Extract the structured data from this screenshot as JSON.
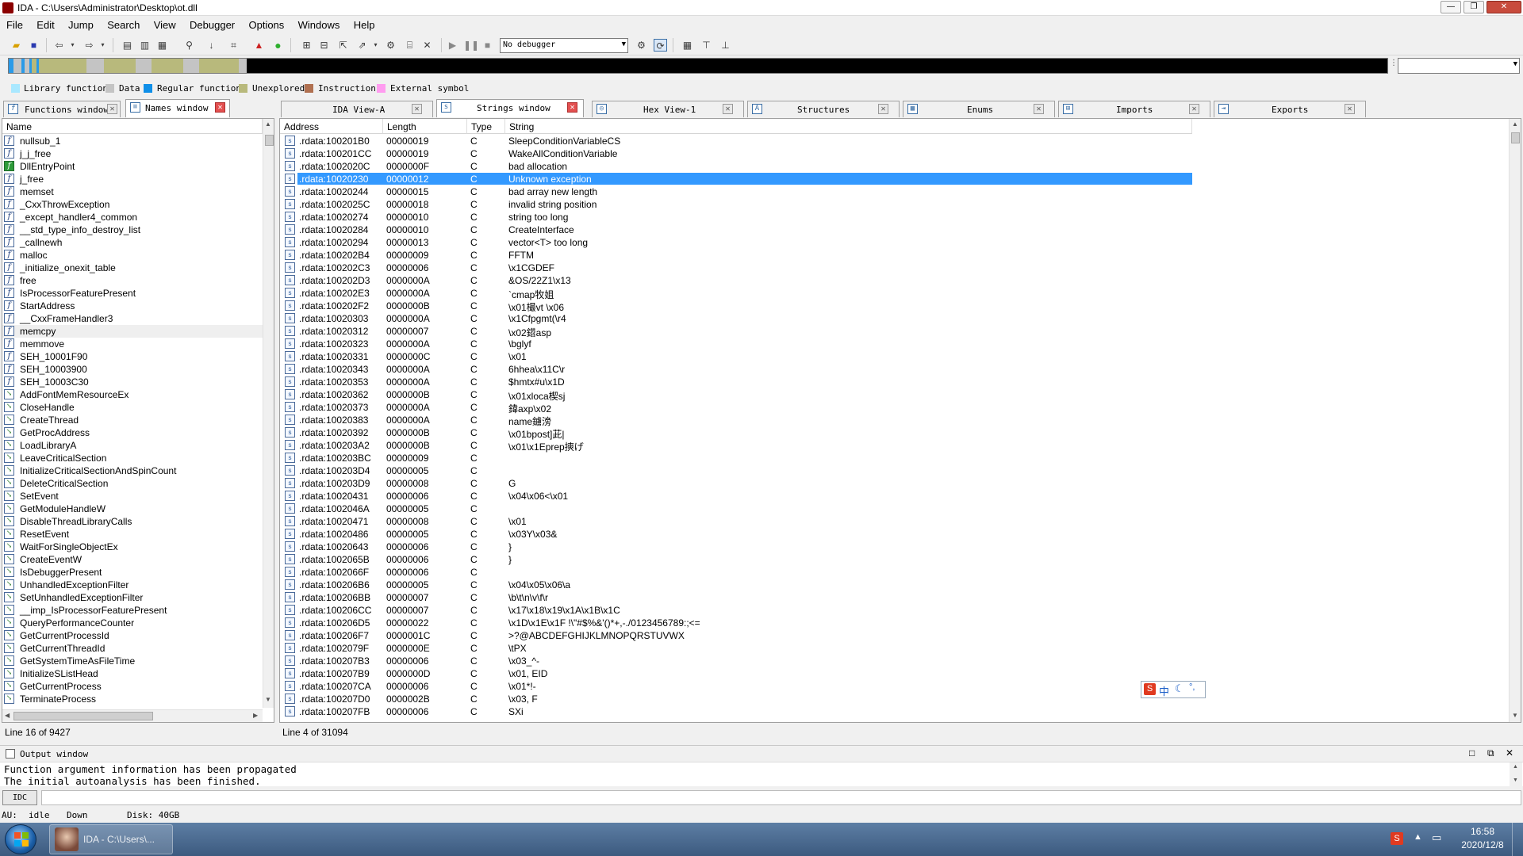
{
  "window": {
    "title": "IDA - C:\\Users\\Administrator\\Desktop\\ot.dll",
    "buttons": [
      "—",
      "❐",
      "✕"
    ]
  },
  "menu": [
    "File",
    "Edit",
    "Jump",
    "Search",
    "View",
    "Debugger",
    "Options",
    "Windows",
    "Help"
  ],
  "toolbar": {
    "debugger_combo": "No debugger"
  },
  "legend": [
    {
      "label": "Library function",
      "color": "#a9e8ff"
    },
    {
      "label": "Data",
      "color": "#c4c4c4"
    },
    {
      "label": "Regular function",
      "color": "#0f8fe8"
    },
    {
      "label": "Unexplored",
      "color": "#b8b97c"
    },
    {
      "label": "Instruction",
      "color": "#b07050"
    },
    {
      "label": "External symbol",
      "color": "#ff9cf0"
    }
  ],
  "left_tabs": [
    {
      "label": "Functions window",
      "active": false
    },
    {
      "label": "Names window",
      "active": true
    }
  ],
  "right_tabs": [
    {
      "label": "IDA View-A",
      "active": false
    },
    {
      "label": "Strings window",
      "active": true
    },
    {
      "label": "Hex View-1",
      "active": false
    },
    {
      "label": "Structures",
      "active": false
    },
    {
      "label": "Enums",
      "active": false
    },
    {
      "label": "Imports",
      "active": false
    },
    {
      "label": "Exports",
      "active": false
    }
  ],
  "names": {
    "header": "Name",
    "items": [
      {
        "name": "nullsub_1",
        "icon": "f"
      },
      {
        "name": "j_j_free",
        "icon": "f"
      },
      {
        "name": "DllEntryPoint",
        "icon": "F"
      },
      {
        "name": "j_free",
        "icon": "f"
      },
      {
        "name": "memset",
        "icon": "f"
      },
      {
        "name": "_CxxThrowException",
        "icon": "f"
      },
      {
        "name": "_except_handler4_common",
        "icon": "f"
      },
      {
        "name": "__std_type_info_destroy_list",
        "icon": "f"
      },
      {
        "name": "_callnewh",
        "icon": "f"
      },
      {
        "name": "malloc",
        "icon": "f"
      },
      {
        "name": "_initialize_onexit_table",
        "icon": "f"
      },
      {
        "name": "free",
        "icon": "f"
      },
      {
        "name": "IsProcessorFeaturePresent",
        "icon": "f"
      },
      {
        "name": "StartAddress",
        "icon": "f"
      },
      {
        "name": "__CxxFrameHandler3",
        "icon": "f"
      },
      {
        "name": "memcpy",
        "icon": "f"
      },
      {
        "name": "memmove",
        "icon": "f"
      },
      {
        "name": "SEH_10001F90",
        "icon": "f"
      },
      {
        "name": "SEH_10003900",
        "icon": "f"
      },
      {
        "name": "SEH_10003C30",
        "icon": "f"
      },
      {
        "name": "AddFontMemResourceEx",
        "icon": "i"
      },
      {
        "name": "CloseHandle",
        "icon": "i"
      },
      {
        "name": "CreateThread",
        "icon": "i"
      },
      {
        "name": "GetProcAddress",
        "icon": "i"
      },
      {
        "name": "LoadLibraryA",
        "icon": "i"
      },
      {
        "name": "LeaveCriticalSection",
        "icon": "i"
      },
      {
        "name": "InitializeCriticalSectionAndSpinCount",
        "icon": "i"
      },
      {
        "name": "DeleteCriticalSection",
        "icon": "i"
      },
      {
        "name": "SetEvent",
        "icon": "i"
      },
      {
        "name": "GetModuleHandleW",
        "icon": "i"
      },
      {
        "name": "DisableThreadLibraryCalls",
        "icon": "i"
      },
      {
        "name": "ResetEvent",
        "icon": "i"
      },
      {
        "name": "WaitForSingleObjectEx",
        "icon": "i"
      },
      {
        "name": "CreateEventW",
        "icon": "i"
      },
      {
        "name": "IsDebuggerPresent",
        "icon": "i"
      },
      {
        "name": "UnhandledExceptionFilter",
        "icon": "i"
      },
      {
        "name": "SetUnhandledExceptionFilter",
        "icon": "i"
      },
      {
        "name": "__imp_IsProcessorFeaturePresent",
        "icon": "i"
      },
      {
        "name": "QueryPerformanceCounter",
        "icon": "i"
      },
      {
        "name": "GetCurrentProcessId",
        "icon": "i"
      },
      {
        "name": "GetCurrentThreadId",
        "icon": "i"
      },
      {
        "name": "GetSystemTimeAsFileTime",
        "icon": "i"
      },
      {
        "name": "InitializeSListHead",
        "icon": "i"
      },
      {
        "name": "GetCurrentProcess",
        "icon": "i"
      },
      {
        "name": "TerminateProcess",
        "icon": "i"
      }
    ],
    "highlighted_index": 15,
    "status": "Line 16 of 9427"
  },
  "strings": {
    "headers": [
      "Address",
      "Length",
      "Type",
      "String"
    ],
    "rows": [
      [
        ".rdata:100201B0",
        "00000019",
        "C",
        "SleepConditionVariableCS"
      ],
      [
        ".rdata:100201CC",
        "00000019",
        "C",
        "WakeAllConditionVariable"
      ],
      [
        ".rdata:1002020C",
        "0000000F",
        "C",
        "bad allocation"
      ],
      [
        ".rdata:10020230",
        "00000012",
        "C",
        "Unknown exception"
      ],
      [
        ".rdata:10020244",
        "00000015",
        "C",
        "bad array new length"
      ],
      [
        ".rdata:1002025C",
        "00000018",
        "C",
        "invalid string position"
      ],
      [
        ".rdata:10020274",
        "00000010",
        "C",
        "string too long"
      ],
      [
        ".rdata:10020284",
        "00000010",
        "C",
        "CreateInterface"
      ],
      [
        ".rdata:10020294",
        "00000013",
        "C",
        "vector<T> too long"
      ],
      [
        ".rdata:100202B4",
        "00000009",
        "C",
        "FFTM"
      ],
      [
        ".rdata:100202C3",
        "00000006",
        "C",
        "\\x1CGDEF"
      ],
      [
        ".rdata:100202D3",
        "0000000A",
        "C",
        "&OS/22Z1\\x13"
      ],
      [
        ".rdata:100202E3",
        "0000000A",
        "C",
        "`cmap牧姐"
      ],
      [
        ".rdata:100202F2",
        "0000000B",
        "C",
        "\\x01樶vt \\x06"
      ],
      [
        ".rdata:10020303",
        "0000000A",
        "C",
        "\\x1Cfpgmt(\\r4"
      ],
      [
        ".rdata:10020312",
        "00000007",
        "C",
        "\\x02鍣asp"
      ],
      [
        ".rdata:10020323",
        "0000000A",
        "C",
        "\\bglyf"
      ],
      [
        ".rdata:10020331",
        "0000000C",
        "C",
        "\\x01"
      ],
      [
        ".rdata:10020343",
        "0000000A",
        "C",
        "6hhea\\x11C\\r"
      ],
      [
        ".rdata:10020353",
        "0000000A",
        "C",
        "$hmtx#u\\x1D"
      ],
      [
        ".rdata:10020362",
        "0000000B",
        "C",
        "\\x01xloca楔sj"
      ],
      [
        ".rdata:10020373",
        "0000000A",
        "C",
        "鍏axp\\x02"
      ],
      [
        ".rdata:10020383",
        "0000000A",
        "C",
        " name鐪滂"
      ],
      [
        ".rdata:10020392",
        "0000000B",
        "C",
        "\\x01bpost]茈|"
      ],
      [
        ".rdata:100203A2",
        "0000000B",
        "C",
        "\\x01\\x1Eprep摤げ"
      ],
      [
        ".rdata:100203BC",
        "00000009",
        "C",
        ""
      ],
      [
        ".rdata:100203D4",
        "00000005",
        "C",
        ""
      ],
      [
        ".rdata:100203D9",
        "00000008",
        "C",
        "G"
      ],
      [
        ".rdata:10020431",
        "00000006",
        "C",
        "\\x04\\x06<\\x01"
      ],
      [
        ".rdata:1002046A",
        "00000005",
        "C",
        ""
      ],
      [
        ".rdata:10020471",
        "00000008",
        "C",
        "\\x01"
      ],
      [
        ".rdata:10020486",
        "00000005",
        "C",
        "\\x03Y\\x03&"
      ],
      [
        ".rdata:10020643",
        "00000006",
        "C",
        "}"
      ],
      [
        ".rdata:1002065B",
        "00000006",
        "C",
        "}"
      ],
      [
        ".rdata:1002066F",
        "00000006",
        "C",
        ""
      ],
      [
        ".rdata:100206B6",
        "00000005",
        "C",
        "\\x04\\x05\\x06\\a"
      ],
      [
        ".rdata:100206BB",
        "00000007",
        "C",
        "\\b\\t\\n\\v\\f\\r"
      ],
      [
        ".rdata:100206CC",
        "00000007",
        "C",
        "\\x17\\x18\\x19\\x1A\\x1B\\x1C"
      ],
      [
        ".rdata:100206D5",
        "00000022",
        "C",
        "\\x1D\\x1E\\x1F !\\\"#$%&'()*+,-./0123456789:;<="
      ],
      [
        ".rdata:100206F7",
        "0000001C",
        "C",
        ">?@ABCDEFGHIJKLMNOPQRSTUVWX"
      ],
      [
        ".rdata:1002079F",
        "0000000E",
        "C",
        "\\tPX"
      ],
      [
        ".rdata:100207B3",
        "00000006",
        "C",
        "\\x03_^-"
      ],
      [
        ".rdata:100207B9",
        "0000000D",
        "C",
        "\\x01,  EID"
      ],
      [
        ".rdata:100207CA",
        "00000006",
        "C",
        "\\x01*!-"
      ],
      [
        ".rdata:100207D0",
        "0000002B",
        "C",
        "\\x03, F"
      ],
      [
        ".rdata:100207FB",
        "00000006",
        "C",
        "SXi"
      ]
    ],
    "selected_index": 3,
    "status": "Line 4 of 31094"
  },
  "ime": {
    "label": "中"
  },
  "output": {
    "title": "Output window",
    "lines": [
      "Function argument information has been propagated",
      "The initial autoanalysis has been finished."
    ],
    "idc_button": "IDC"
  },
  "statusbar": {
    "au_label": "AU:",
    "au_state": "idle",
    "direction": "Down",
    "disk": "Disk: 40GB"
  },
  "taskbar": {
    "item_label": "IDA - C:\\Users\\...",
    "time": "16:58",
    "date": "2020/12/8"
  }
}
